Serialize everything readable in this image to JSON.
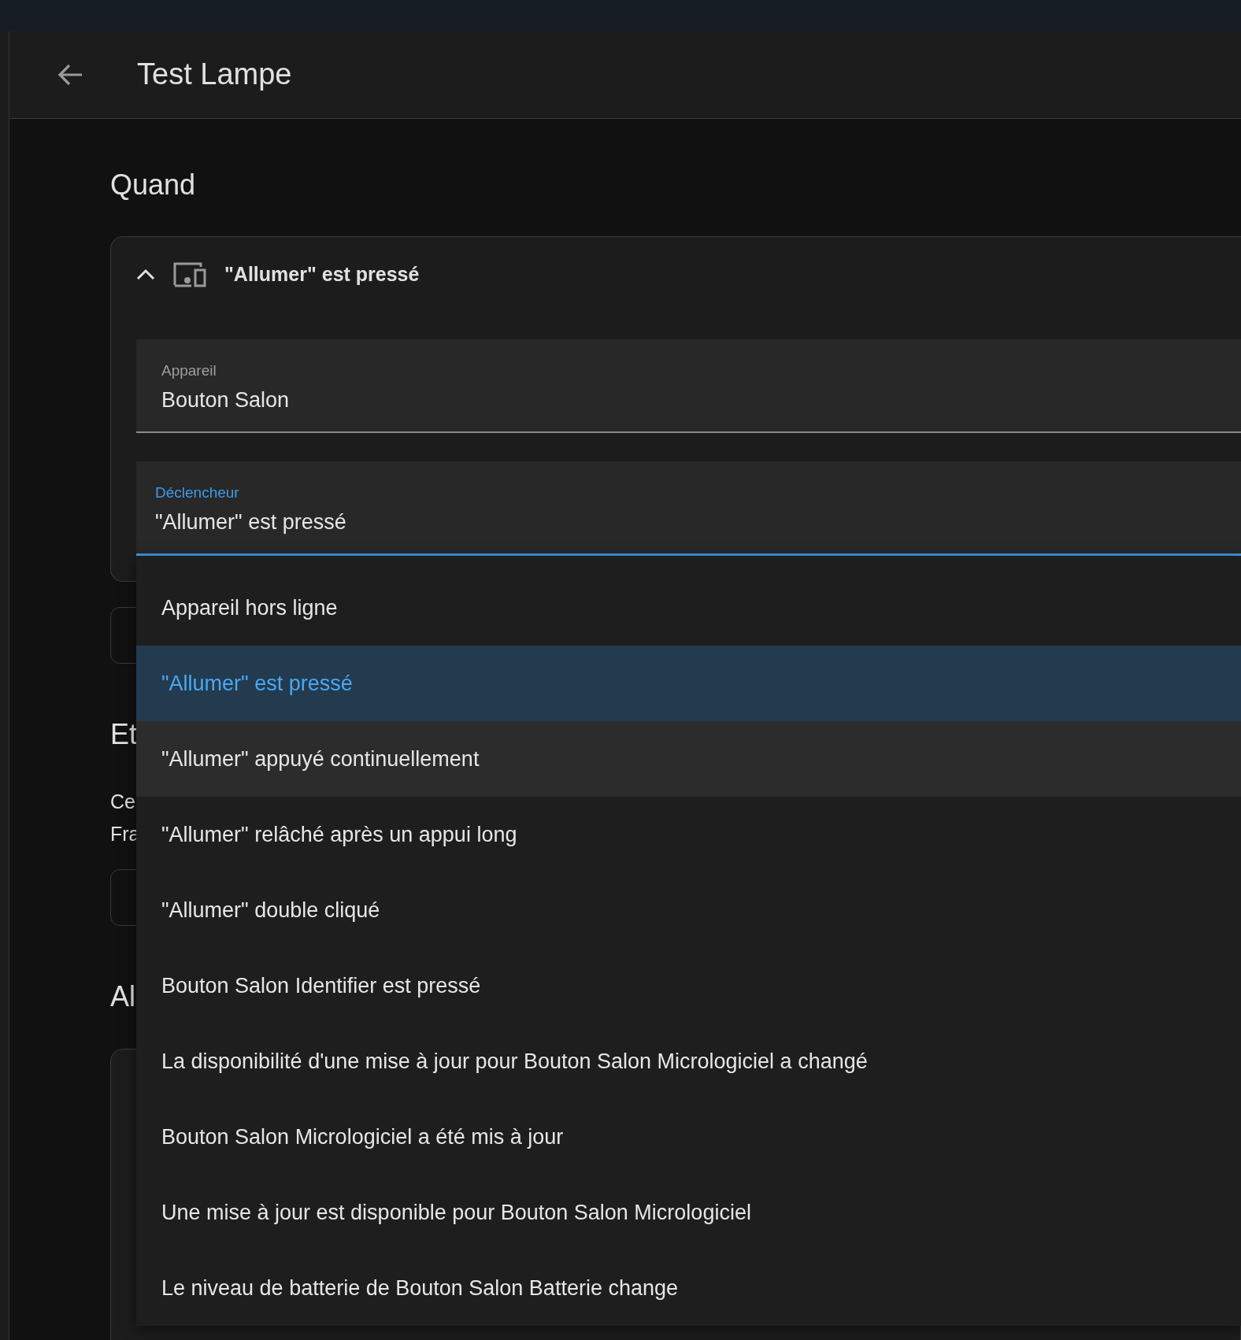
{
  "header": {
    "title": "Test Lampe"
  },
  "sections": [
    {
      "kind": "triggers",
      "heading": "Quand",
      "triggers": [
        {
          "title": "\"Allumer\" est pressé",
          "expanded": true,
          "fields": [
            {
              "label": "Appareil",
              "value": "Bouton Salon",
              "focused": false
            },
            {
              "label": "Déclencheur",
              "value": "\"Allumer\" est pressé",
              "focused": true,
              "options": [
                {
                  "label": "Appareil hors ligne",
                  "selected": false,
                  "hovered": false
                },
                {
                  "label": "\"Allumer\" est pressé",
                  "selected": true,
                  "hovered": false
                },
                {
                  "label": "\"Allumer\" appuyé continuellement",
                  "selected": false,
                  "hovered": true
                },
                {
                  "label": "\"Allumer\" relâché après un appui long",
                  "selected": false,
                  "hovered": false
                },
                {
                  "label": "\"Allumer\" double cliqué",
                  "selected": false,
                  "hovered": false
                },
                {
                  "label": "Bouton Salon Identifier est pressé",
                  "selected": false,
                  "hovered": false
                },
                {
                  "label": "La disponibilité d'une mise à jour pour Bouton Salon Micrologiciel a changé",
                  "selected": false,
                  "hovered": false
                },
                {
                  "label": "Bouton Salon Micrologiciel a été mis à jour",
                  "selected": false,
                  "hovered": false
                },
                {
                  "label": "Une mise à jour est disponible pour Bouton Salon Micrologiciel",
                  "selected": false,
                  "hovered": false
                },
                {
                  "label": "Le niveau de batterie de Bouton Salon Batterie change",
                  "selected": false,
                  "hovered": false
                }
              ]
            }
          ]
        }
      ]
    },
    {
      "kind": "conditions",
      "heading": "Et",
      "description": [
        "Ce",
        "Fra"
      ]
    },
    {
      "kind": "actions",
      "heading": "Al"
    }
  ]
}
